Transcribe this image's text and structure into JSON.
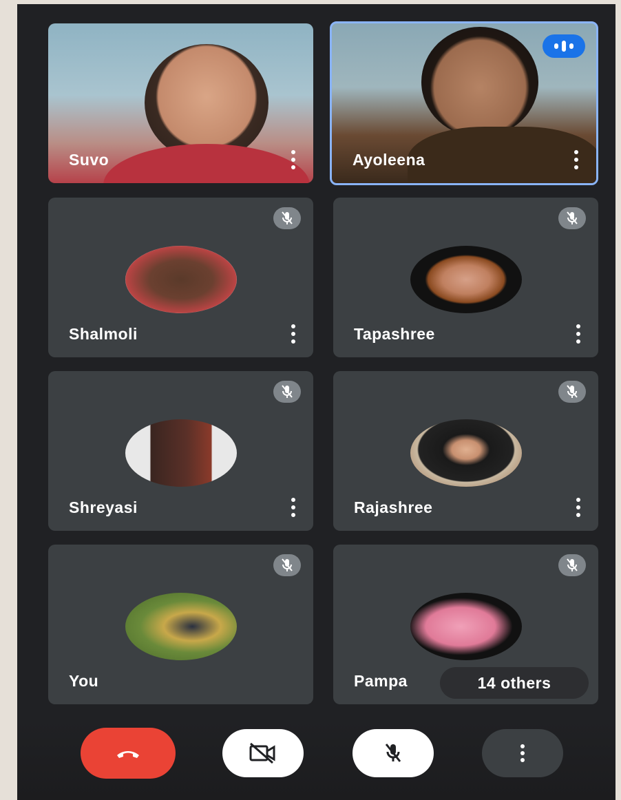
{
  "participants": [
    {
      "name": "Suvo",
      "type": "video",
      "speaking": false
    },
    {
      "name": "Ayoleena",
      "type": "video",
      "speaking": true
    },
    {
      "name": "Shalmoli",
      "type": "avatar",
      "muted": true
    },
    {
      "name": "Tapashree",
      "type": "avatar",
      "muted": true
    },
    {
      "name": "Shreyasi",
      "type": "avatar",
      "muted": true
    },
    {
      "name": "Rajashree",
      "type": "avatar",
      "muted": true
    },
    {
      "name": "You",
      "type": "avatar",
      "muted": true
    },
    {
      "name": "Pampa",
      "type": "avatar",
      "muted": true
    }
  ],
  "others_chip": "14 others",
  "controls": {
    "end_call_icon": "phone-hangup-icon",
    "camera_icon": "camera-off-icon",
    "mic_icon": "mic-off-icon",
    "more_icon": "more-vertical-icon"
  },
  "colors": {
    "background": "#202124",
    "tile": "#3c4043",
    "end_call": "#ea4335",
    "speaking_accent": "#1a73e8",
    "active_border": "#8ab4f8"
  }
}
